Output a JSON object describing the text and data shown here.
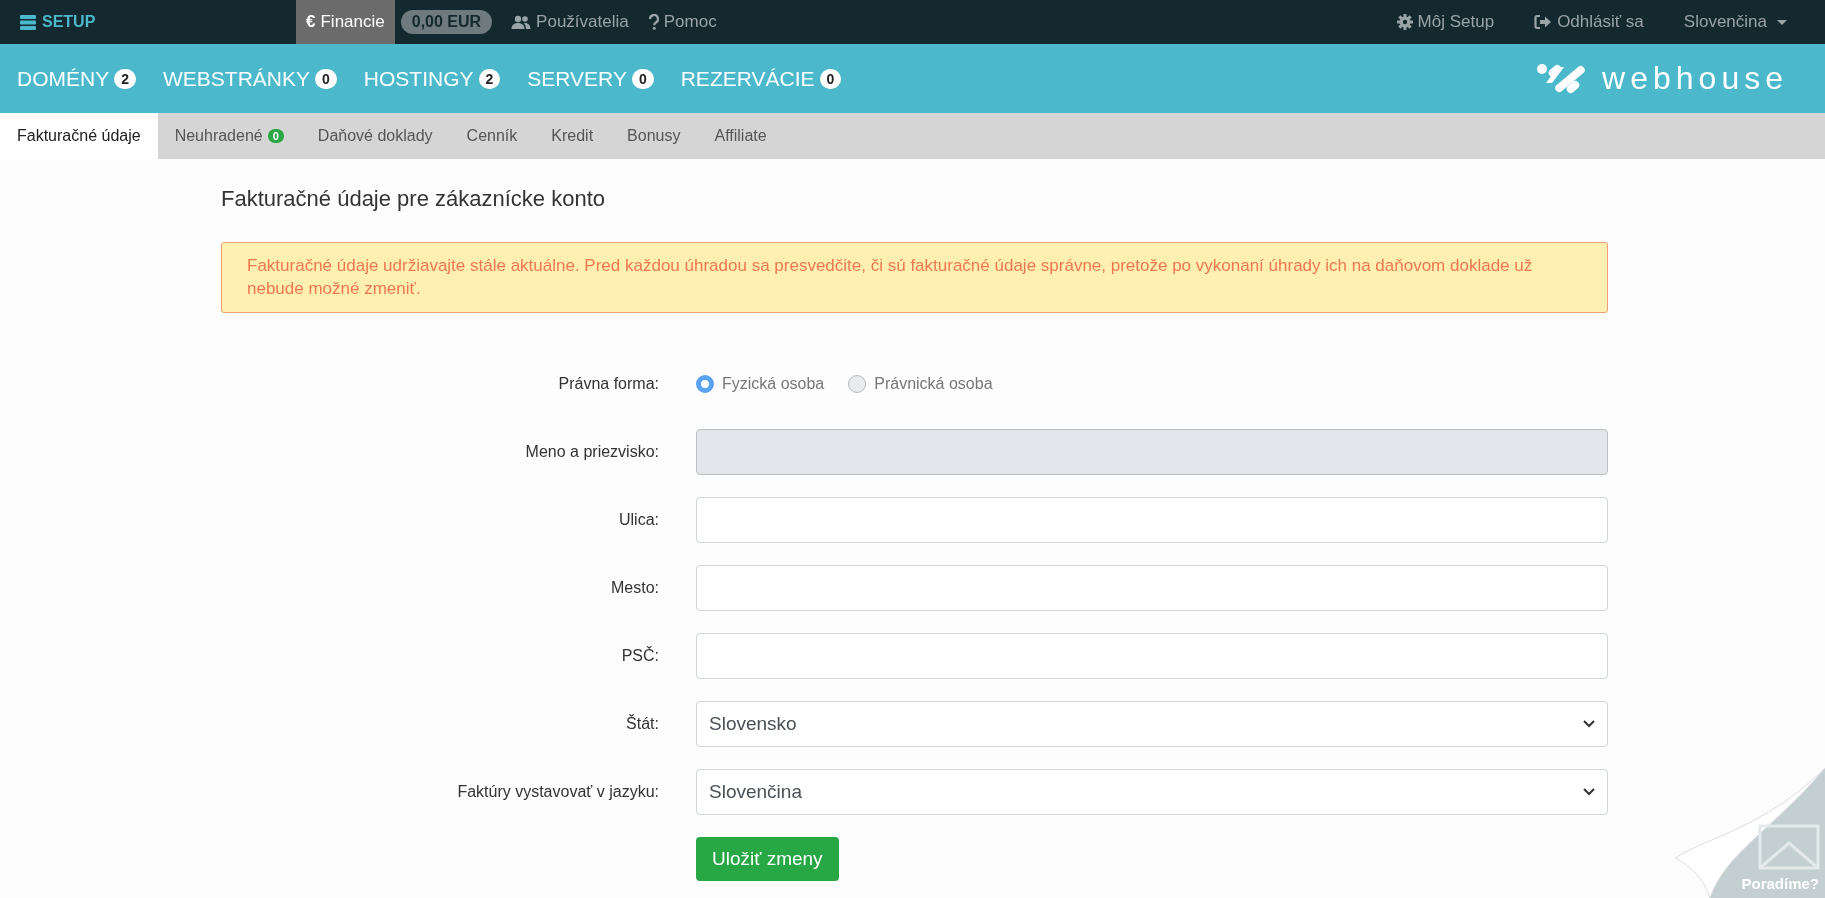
{
  "top_bar": {
    "brand": "SETUP",
    "items": [
      {
        "kind": "euro",
        "icon": "€",
        "label": "Financie",
        "selected": true
      },
      {
        "kind": "balance",
        "label": "0,00 EUR",
        "selected": false
      },
      {
        "kind": "users",
        "label": "Používatelia",
        "selected": false
      },
      {
        "kind": "help",
        "label": "Pomoc",
        "selected": false
      }
    ],
    "right_items": [
      {
        "kind": "gear",
        "label": "Môj Setup"
      },
      {
        "kind": "logout",
        "label": "Odhlásiť sa"
      },
      {
        "kind": "dropdown",
        "label": "Slovenčina"
      }
    ]
  },
  "main_nav": {
    "items": [
      {
        "label": "DOMÉNY",
        "count": "2"
      },
      {
        "label": "WEBSTRÁNKY",
        "count": "0"
      },
      {
        "label": "HOSTINGY",
        "count": "2"
      },
      {
        "label": "SERVERY",
        "count": "0"
      },
      {
        "label": "REZERVÁCIE",
        "count": "0"
      }
    ],
    "logo": "webhouse"
  },
  "sub_nav": [
    {
      "label": "Fakturačné údaje",
      "selected": true
    },
    {
      "label": "Neuhradené",
      "count": "0",
      "selected": false
    },
    {
      "label": "Daňové doklady",
      "selected": false
    },
    {
      "label": "Cenník",
      "selected": false
    },
    {
      "label": "Kredit",
      "selected": false
    },
    {
      "label": "Bonusy",
      "selected": false
    },
    {
      "label": "Affiliate",
      "selected": false
    }
  ],
  "page_title": "Fakturačné údaje pre zákaznícke konto",
  "alert": "Fakturačné údaje udržiavajte stále aktuálne. Pred každou úhradou sa presvedčite, či sú fakturačné údaje správne, pretože po vykonaní úhrady ich na daňovom doklade už nebude možné zmeniť.",
  "form": {
    "rows": [
      {
        "kind": "radio",
        "label": "Právna forma:",
        "options": [
          {
            "label": "Fyzická osoba",
            "selected": true
          },
          {
            "label": "Právnická osoba",
            "selected": false
          }
        ]
      },
      {
        "kind": "text",
        "label": "Meno a priezvisko:",
        "disabled": true
      },
      {
        "kind": "text",
        "label": "Ulica:",
        "disabled": false
      },
      {
        "kind": "text",
        "label": "Mesto:",
        "disabled": false
      },
      {
        "kind": "text",
        "label": "PSČ:",
        "disabled": false
      },
      {
        "kind": "select",
        "label": "Štát:",
        "value": "Slovensko"
      },
      {
        "kind": "select",
        "label": "Faktúry vystavovať v jazyku:",
        "value": "Slovenčina"
      }
    ],
    "submit": "Uložiť zmeny"
  },
  "help_corner": {
    "label": "Poradíme?"
  }
}
